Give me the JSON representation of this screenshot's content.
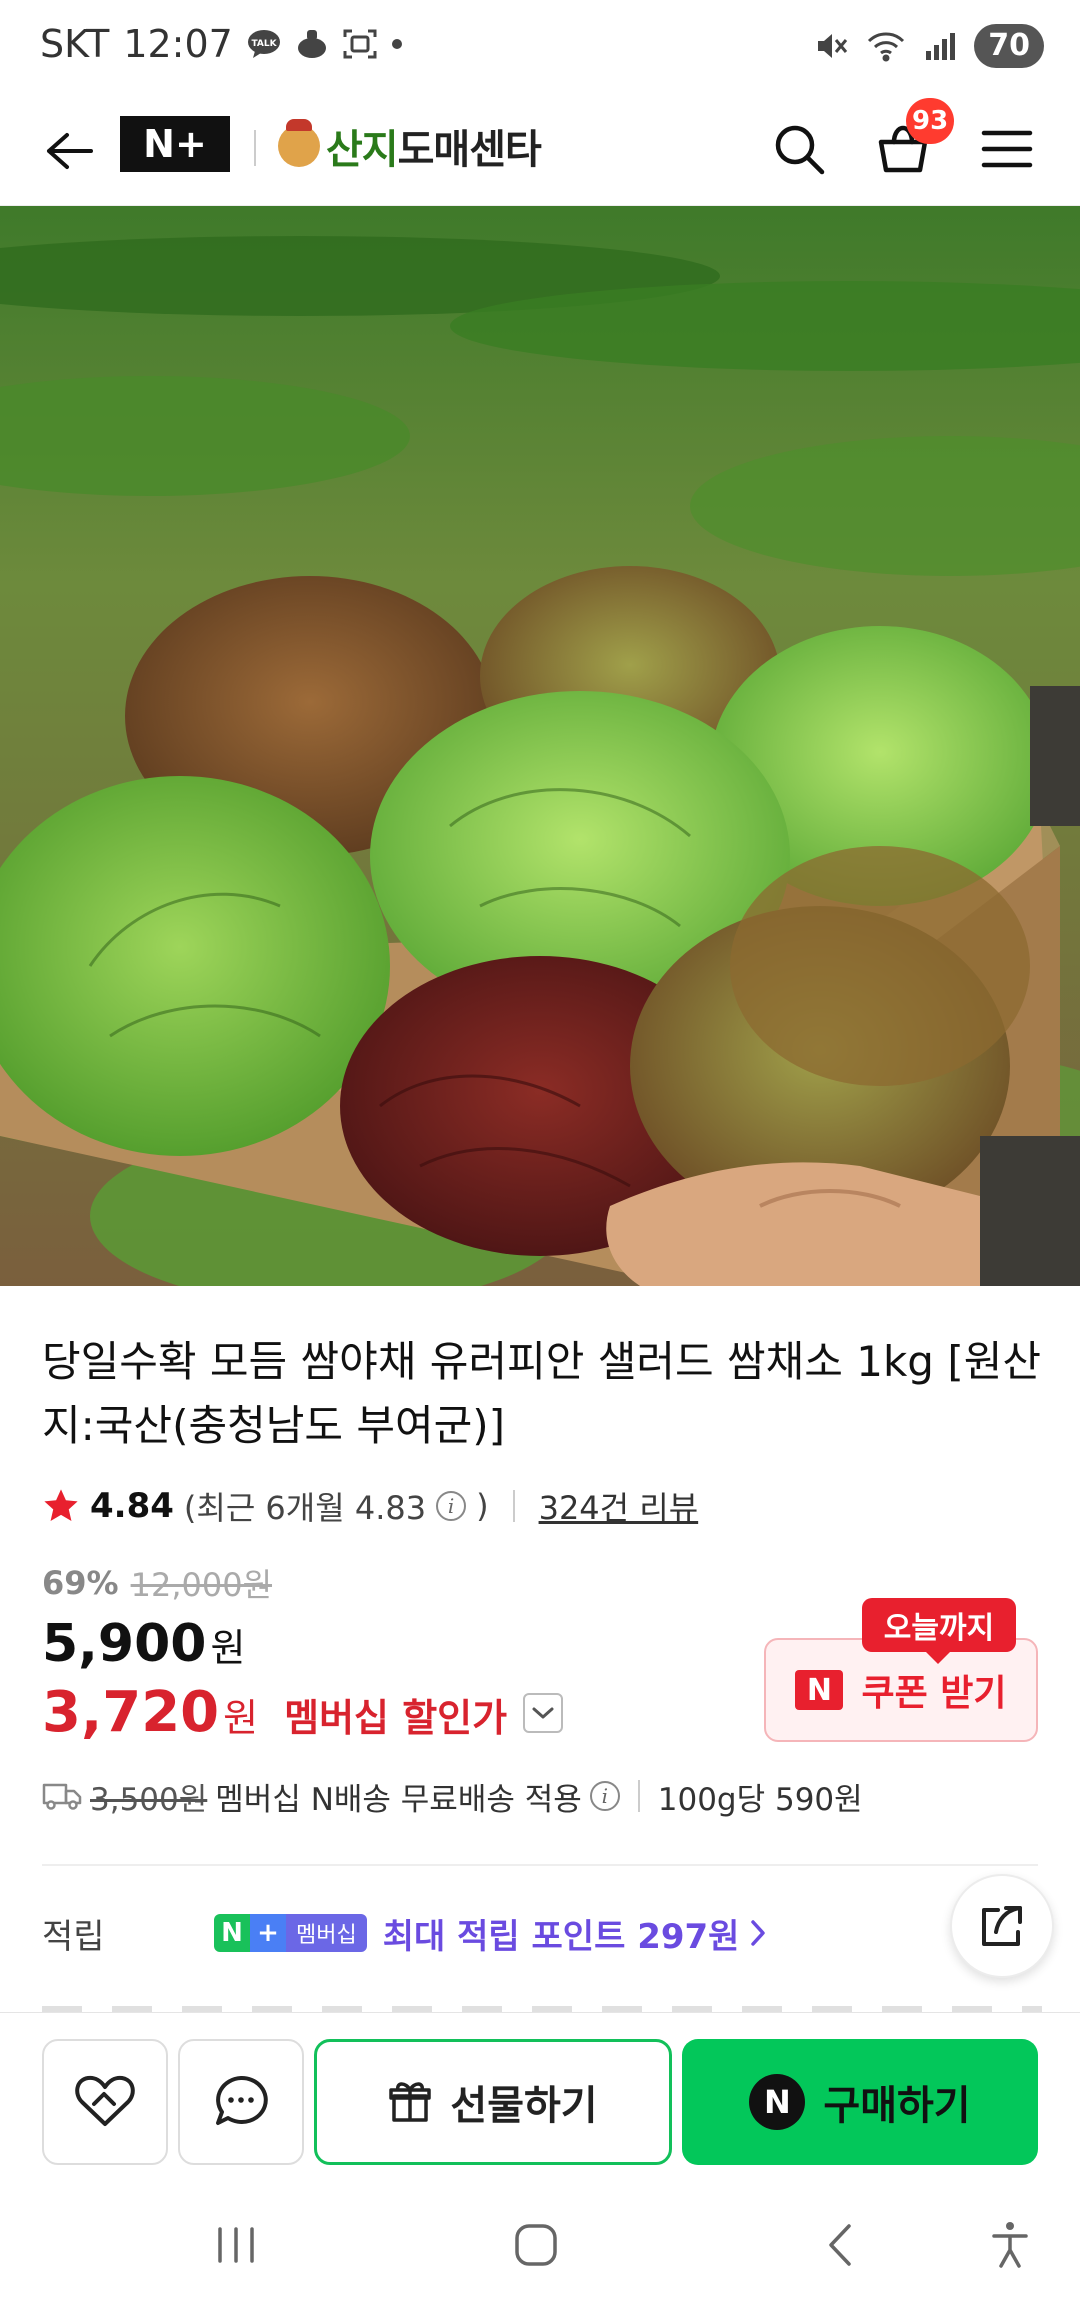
{
  "status": {
    "carrier": "SKT",
    "time": "12:07",
    "battery": "70"
  },
  "header": {
    "np_logo": "N+",
    "store_name_green": "산지",
    "store_name_dark": "도매센타",
    "cart_count": "93"
  },
  "product": {
    "title": "당일수확 모듬 쌈야채 유러피안 샐러드 쌈채소 1kg [원산지:국산(충청남도 부여군)]",
    "rating": "4.84",
    "rating_recent": "(최근 6개월 4.83",
    "rating_close": ")",
    "review_link": "324건 리뷰",
    "discount_rate": "69%",
    "original_price": "12,000원",
    "price": "5,900",
    "price_unit": "원",
    "member_price": "3,720",
    "member_unit": "원",
    "member_label": "멤버십 할인가"
  },
  "coupon": {
    "tag": "오늘까지",
    "n": "N",
    "label": "쿠폰 받기"
  },
  "shipping": {
    "orig_fee": "3,500원",
    "text": "멤버십 N배송 무료배송 적용",
    "unit_price": "100g당 590원"
  },
  "reward": {
    "label": "적립",
    "badge_n": "N",
    "badge_plus": "+",
    "badge_text": "멤버십",
    "text": "최대 적립 포인트 297원"
  },
  "bottom": {
    "gift_label": "선물하기",
    "buy_n": "N",
    "buy_label": "구매하기"
  },
  "colors": {
    "naver_green": "#03c75a",
    "price_red": "#d8232e",
    "reward_purple": "#6a4be0",
    "store_green": "#2a7a1a"
  },
  "icons": [
    "back-arrow-icon",
    "search-icon",
    "cart-icon",
    "menu-icon",
    "star-icon",
    "truck-icon",
    "info-icon",
    "chevron-down-icon",
    "chevron-right-icon",
    "share-icon",
    "heart-icon",
    "chat-icon",
    "gift-icon"
  ]
}
